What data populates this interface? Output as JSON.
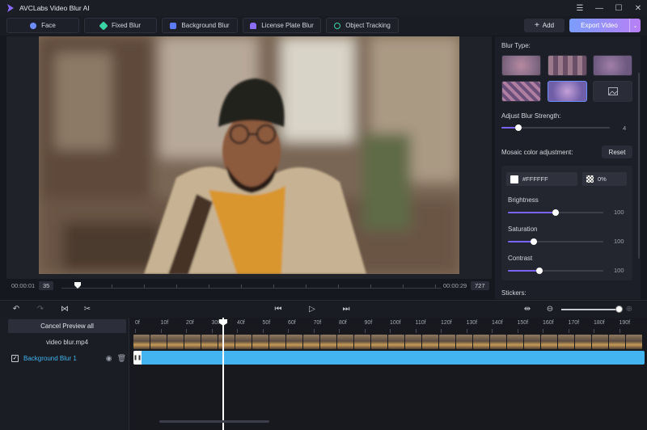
{
  "app": {
    "title": "AVCLabs Video Blur AI"
  },
  "window_controls": [
    "☰",
    "—",
    "☐",
    "✕"
  ],
  "tabs": [
    {
      "label": "Face",
      "icon": "face-icon",
      "color": "#6c8cff"
    },
    {
      "label": "Fixed Blur",
      "icon": "fixed-blur-icon",
      "color": "#3bd3a5"
    },
    {
      "label": "Background Blur",
      "icon": "background-blur-icon",
      "color": "#5b7cf5"
    },
    {
      "label": "License Plate Blur",
      "icon": "car-icon",
      "color": "#8b6cf5"
    },
    {
      "label": "Object Tracking",
      "icon": "object-tracking-icon",
      "color": "#3bd3a5"
    }
  ],
  "toolbar": {
    "add_label": "Add",
    "add_icon": "+",
    "export_label": "Export Video",
    "export_dropdown": "⌄"
  },
  "player": {
    "current_time": "00:00:01",
    "current_frame": "35",
    "end_time": "00:00:29",
    "end_frame": "727"
  },
  "panel": {
    "blur_type_label": "Blur Type:",
    "blur_strength_label": "Adjust Blur Strength:",
    "blur_strength_value": "4",
    "blur_strength_fraction": 0.16,
    "mosaic_label": "Mosaic color adjustment:",
    "reset_label": "Reset",
    "color_hex": "#FFFFFF",
    "opacity": "0%",
    "brightness_label": "Brightness",
    "brightness_value": "100",
    "brightness_fraction": 0.5,
    "saturation_label": "Saturation",
    "saturation_value": "100",
    "saturation_fraction": 0.27,
    "contrast_label": "Contrast",
    "contrast_value": "100",
    "contrast_fraction": 0.33,
    "stickers_label": "Stickers:"
  },
  "timeline": {
    "cancel_preview_label": "Cancel Preview all",
    "file_name": "video blur.mp4",
    "layer_name": "Background Blur 1",
    "ruler_labels": [
      "0f",
      "10f",
      "20f",
      "30f",
      "40f",
      "50f",
      "60f",
      "70f",
      "80f",
      "90f",
      "100f",
      "110f",
      "120f",
      "130f",
      "140f",
      "150f",
      "160f",
      "170f",
      "180f",
      "190f"
    ]
  },
  "colors": {
    "accent": "#7a63f5",
    "blur_track": "#43b4ef",
    "export_gradient_start": "#7b9dfd",
    "export_gradient_end": "#b87ff5"
  }
}
